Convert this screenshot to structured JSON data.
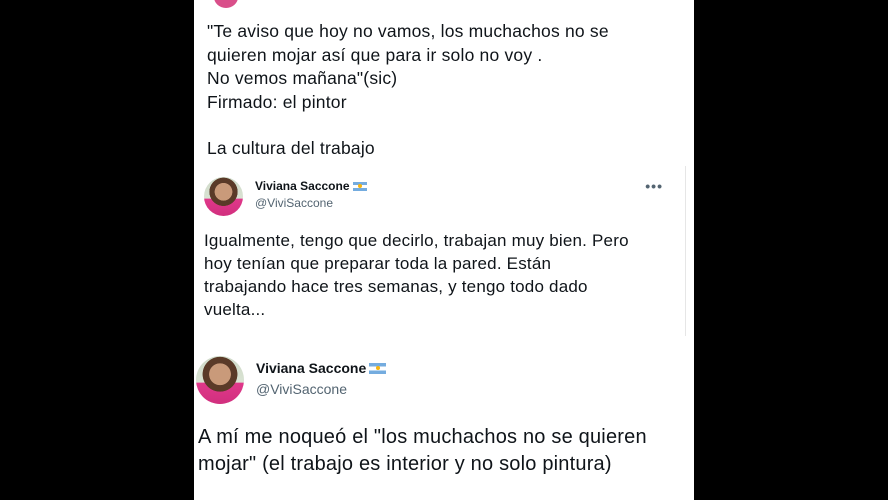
{
  "tweet_top": {
    "lines": [
      "\"Te aviso que hoy no vamos, los muchachos no se",
      "quieren mojar así que para ir solo no voy .",
      "No vemos mañana\"(sic)",
      "Firmado: el pintor",
      "",
      "La cultura del trabajo"
    ]
  },
  "quoted_tweet": {
    "name": "Viviana Saccone",
    "flag_icon": "argentina-flag-emoji",
    "handle": "@ViviSaccone",
    "more_label": "•••",
    "lines": [
      "Igualmente, tengo que decirlo, trabajan muy bien. Pero",
      "hoy tenían que preparar toda la pared. Están",
      "trabajando hace tres semanas, y tengo todo dado",
      "vuelta..."
    ]
  },
  "reply_tweet": {
    "name": "Viviana Saccone",
    "flag_icon": "argentina-flag-emoji",
    "handle": "@ViviSaccone",
    "lines": [
      "A mí me noqueó el \"los muchachos no se quieren",
      "mojar\" (el trabajo es interior y no solo pintura)"
    ]
  },
  "colors": {
    "background": "#000000",
    "panel": "#ffffff",
    "text": "#0f1419",
    "secondary_text": "#536471"
  }
}
